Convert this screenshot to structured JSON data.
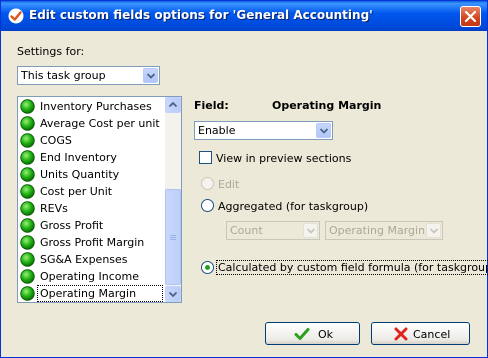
{
  "window": {
    "title": "Edit custom fields options for  'General Accounting'"
  },
  "settings": {
    "label": "Settings for:",
    "selected": "This task group"
  },
  "list": {
    "items": [
      {
        "label": "Inventory Purchases"
      },
      {
        "label": "Average Cost per unit"
      },
      {
        "label": "COGS"
      },
      {
        "label": "End Inventory"
      },
      {
        "label": "Units Quantity"
      },
      {
        "label": "Cost per Unit"
      },
      {
        "label": "REVs"
      },
      {
        "label": "Gross Profit"
      },
      {
        "label": "Gross Profit Margin"
      },
      {
        "label": "SG&A Expenses"
      },
      {
        "label": "Operating Income"
      },
      {
        "label": "Operating Margin"
      }
    ],
    "selected_index": 11,
    "item_icon": "green-circle-icon"
  },
  "field": {
    "label": "Field:",
    "name": "Operating Margin",
    "mode_selected": "Enable",
    "view_in_preview_label": "View in preview sections",
    "view_in_preview_checked": false,
    "edit_label": "Edit",
    "aggregated_label": "Aggregated (for taskgroup)",
    "aggregate_function": "Count",
    "aggregate_field": "Operating Margin",
    "calculated_label": "Calculated by custom field formula (for taskgroup)",
    "selected_option": "calculated"
  },
  "buttons": {
    "ok_label": "Ok",
    "cancel_label": "Cancel"
  },
  "colors": {
    "title_bar": "#0058ee",
    "dialog_bg": "#ece9d8",
    "ok_icon": "#2e9e1e",
    "cancel_icon": "#e0261c"
  }
}
